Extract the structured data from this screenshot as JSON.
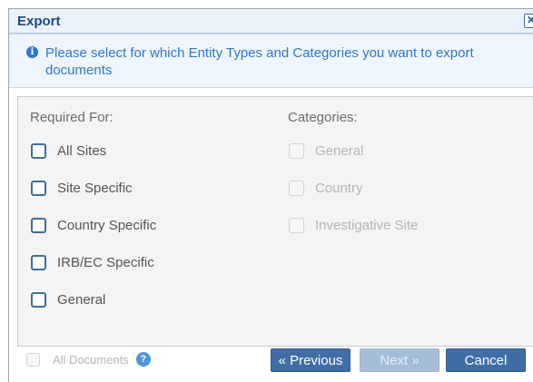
{
  "dialog": {
    "title": "Export",
    "close_label": "✕"
  },
  "info": {
    "icon": "info-icon",
    "text": "Please select for which Entity Types and Categories you want to export documents"
  },
  "required_for": {
    "header": "Required For:",
    "items": [
      {
        "label": "All Sites",
        "checked": false
      },
      {
        "label": "Site Specific",
        "checked": false
      },
      {
        "label": "Country Specific",
        "checked": false
      },
      {
        "label": "IRB/EC Specific",
        "checked": false
      },
      {
        "label": "General",
        "checked": false
      }
    ]
  },
  "categories": {
    "header": "Categories:",
    "items": [
      {
        "label": "General",
        "checked": false,
        "disabled": true
      },
      {
        "label": "Country",
        "checked": false,
        "disabled": true
      },
      {
        "label": "Investigative Site",
        "checked": false,
        "disabled": true
      }
    ]
  },
  "footer": {
    "all_documents_label": "All Documents",
    "help_glyph": "?",
    "previous_label": "« Previous",
    "next_label": "Next »",
    "cancel_label": "Cancel"
  },
  "colors": {
    "title": "#1d4a80",
    "info_text": "#2f78c6",
    "primary_button": "#3f6ea6",
    "disabled_button": "#a6bdd8"
  }
}
